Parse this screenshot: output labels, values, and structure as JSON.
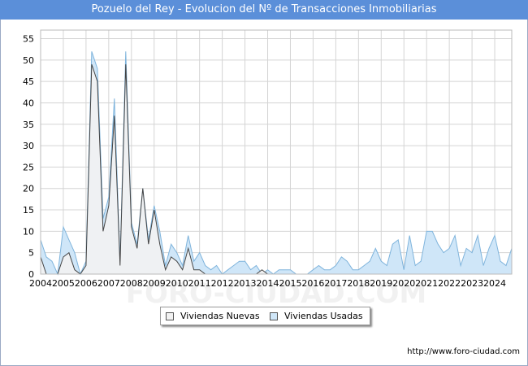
{
  "title": "Pozuelo del Rey - Evolucion del Nº de Transacciones Inmobiliarias",
  "source": "http://www.foro-ciudad.com",
  "watermark": "FORO-CIUDAD.COM",
  "chart_data": {
    "type": "area",
    "title": "Pozuelo del Rey - Evolucion del Nº de Transacciones Inmobiliarias",
    "xlabel": "",
    "ylabel": "",
    "x_ticks": [
      "2004",
      "2005",
      "2006",
      "2007",
      "2008",
      "2009",
      "2010",
      "2011",
      "2012",
      "2013",
      "2014",
      "2015",
      "2016",
      "2017",
      "2018",
      "2019",
      "2020",
      "2021",
      "2022",
      "2023",
      "2024"
    ],
    "x_range": [
      "2004-Q1",
      "2024-Q4"
    ],
    "y_ticks": [
      0,
      5,
      10,
      15,
      20,
      25,
      30,
      35,
      40,
      45,
      50,
      55
    ],
    "ylim": [
      0,
      57
    ],
    "grid": true,
    "legend_position": "bottom-center",
    "colors": {
      "nuevas_fill": "#f2f2f2",
      "nuevas_line": "#444444",
      "usadas_fill": "#cfe6f8",
      "usadas_line": "#7fb4dc",
      "grid": "#d4d4d4"
    },
    "series": [
      {
        "name": "Viviendas Nuevas",
        "values": [
          4,
          0,
          0,
          0,
          4,
          5,
          1,
          0,
          2,
          49,
          45,
          10,
          16,
          37,
          2,
          49,
          11,
          6,
          20,
          7,
          15,
          7,
          1,
          4,
          3,
          1,
          6,
          1,
          1,
          0,
          0,
          0,
          0,
          0,
          0,
          0,
          0,
          0,
          0,
          1,
          0,
          0,
          0,
          0,
          0,
          0,
          0,
          0,
          0,
          0,
          0,
          0,
          0,
          0,
          0,
          0,
          0,
          0,
          0,
          0,
          0,
          0,
          0,
          0,
          0,
          0,
          0,
          0,
          0,
          0,
          0,
          0,
          0,
          0,
          0,
          0,
          0,
          0,
          0,
          0,
          0,
          0,
          0,
          0
        ]
      },
      {
        "name": "Viviendas Usadas",
        "values": [
          8,
          4,
          3,
          0,
          11,
          8,
          5,
          0,
          3,
          52,
          48,
          13,
          18,
          41,
          3,
          52,
          12,
          7,
          20,
          8,
          16,
          10,
          2,
          7,
          5,
          2,
          9,
          3,
          5,
          2,
          1,
          2,
          0,
          1,
          2,
          3,
          3,
          1,
          2,
          0,
          1,
          0,
          1,
          1,
          1,
          0,
          0,
          0,
          1,
          2,
          1,
          1,
          2,
          4,
          3,
          1,
          1,
          2,
          3,
          6,
          3,
          2,
          7,
          8,
          1,
          9,
          2,
          3,
          10,
          10,
          7,
          5,
          6,
          9,
          2,
          6,
          5,
          9,
          2,
          6,
          9,
          3,
          2,
          6
        ]
      }
    ]
  },
  "legend": {
    "items": [
      {
        "label": "Viviendas Nuevas",
        "color": "#f2f2f2"
      },
      {
        "label": "Viviendas Usadas",
        "color": "#cfe6f8"
      }
    ]
  }
}
